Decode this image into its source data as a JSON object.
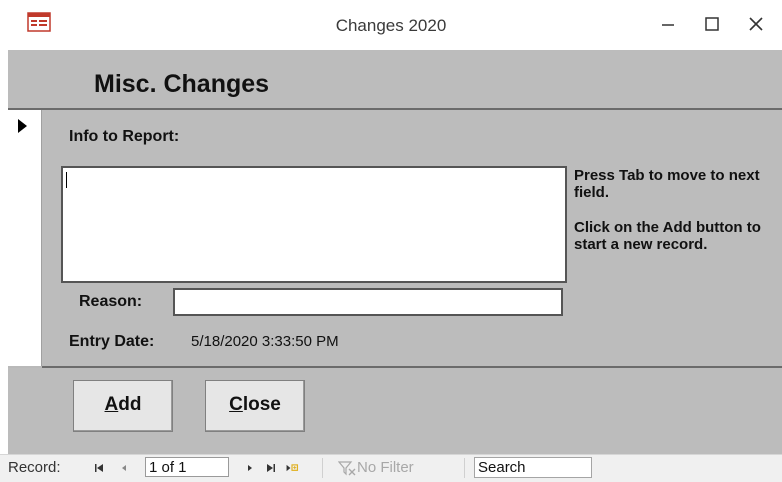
{
  "window": {
    "title": "Changes 2020"
  },
  "form": {
    "title": "Misc. Changes",
    "info_label": "Info to Report:",
    "info_value": "",
    "reason_label": "Reason:",
    "reason_value": "",
    "entry_date_label": "Entry Date:",
    "entry_date_value": "5/18/2020 3:33:50 PM",
    "help_tab": "Press Tab to move to next field.",
    "help_add": "Click on the Add button to start a new record."
  },
  "buttons": {
    "add_hotkey": "A",
    "add_rest": "dd",
    "close_hotkey": "C",
    "close_rest": "lose"
  },
  "navigation": {
    "record_label": "Record:",
    "record_position": "1 of 1",
    "filter_label": "No Filter",
    "search_placeholder": "Search"
  },
  "icons": {
    "app": "form-icon",
    "first": "first-record-icon",
    "prev": "previous-record-icon",
    "next": "next-record-icon",
    "last": "last-record-icon",
    "new": "new-record-icon",
    "filter": "filter-icon",
    "pointer": "current-record-pointer-icon"
  },
  "colors": {
    "form_bg": "#bcbcbc",
    "title_text": "#3a3a3a",
    "new_record_accent": "#e0b020"
  }
}
